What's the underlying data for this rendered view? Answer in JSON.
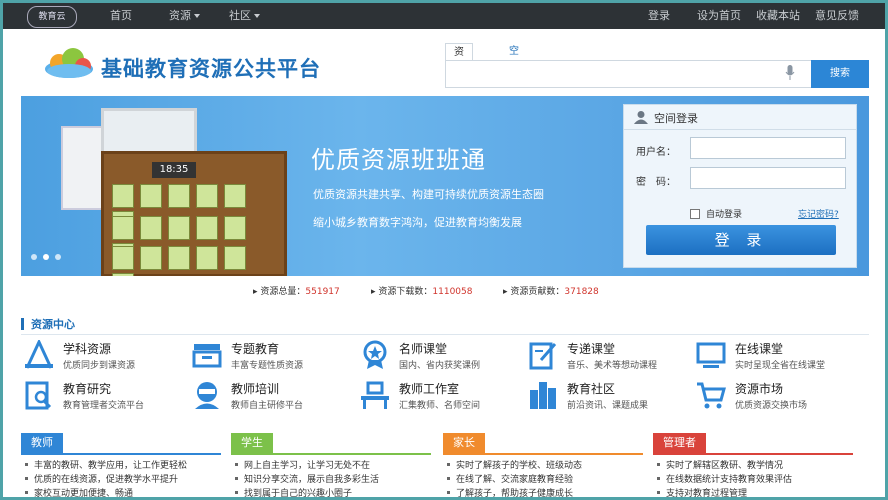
{
  "topbar": {
    "logo": "教育云",
    "nav": [
      {
        "label": "首页"
      },
      {
        "label": "资源"
      },
      {
        "label": "社区"
      }
    ],
    "links": [
      "登录",
      "设为首页",
      "收藏本站",
      "意见反馈"
    ]
  },
  "header": {
    "title": "基础教育资源公共平台",
    "search_tabs": [
      "资源",
      "空间"
    ],
    "search_value": "",
    "search_button": "搜索",
    "mic_icon": "microphone-icon"
  },
  "banner": {
    "title": "优质资源班班通",
    "line1": "优质资源共建共享、构建可持续优质资源生态圈",
    "line2": "缩小城乡教育数字鸿沟，促进教育均衡发展",
    "clock": "18:35"
  },
  "login": {
    "title": "空间登录",
    "username_label": "用户名：",
    "password_label": "密　码：",
    "username_value": "",
    "password_value": "",
    "remember_label": "自动登录",
    "forgot_label": "忘记密码?",
    "submit_label": "登 录"
  },
  "stats": [
    {
      "label": "资源总量：",
      "value": "551917"
    },
    {
      "label": "资源下载数：",
      "value": "1110058"
    },
    {
      "label": "资源贡献数：",
      "value": "371828"
    }
  ],
  "resource_center": {
    "title": "资源中心",
    "items": [
      {
        "title": "学科资源",
        "desc": "优质同步到课资源",
        "icon": "ruler-compass-icon"
      },
      {
        "title": "专题教育",
        "desc": "丰富专题性质资源",
        "icon": "tray-icon"
      },
      {
        "title": "名师课堂",
        "desc": "国内、省内获奖课例",
        "icon": "award-medal-icon"
      },
      {
        "title": "专递课堂",
        "desc": "音乐、美术等想动课程",
        "icon": "edit-document-icon"
      },
      {
        "title": "在线课堂",
        "desc": "实时呈现全省在线课堂",
        "icon": "monitor-icon"
      },
      {
        "title": "教育研究",
        "desc": "教育管理者交流平台",
        "icon": "clipboard-search-icon"
      },
      {
        "title": "教师培训",
        "desc": "教师自主研修平台",
        "icon": "teacher-icon"
      },
      {
        "title": "教师工作室",
        "desc": "汇集教师、名师空间",
        "icon": "desk-icon"
      },
      {
        "title": "教育社区",
        "desc": "前沿资讯、课题成果",
        "icon": "buildings-icon"
      },
      {
        "title": "资源市场",
        "desc": "优质资源交换市场",
        "icon": "shopping-cart-icon"
      }
    ]
  },
  "roles": [
    {
      "name": "教师",
      "color": "#2f86d6",
      "items": [
        "丰富的教研、教学应用，让工作更轻松",
        "优质的在线资源，促进教学水平提升",
        "家校互动更加便捷、畅通"
      ]
    },
    {
      "name": "学生",
      "color": "#7cc14a",
      "items": [
        "网上自主学习，让学习无处不在",
        "知识分享交流，展示自我多彩生活",
        "找到属于自己的兴趣小圈子"
      ]
    },
    {
      "name": "家长",
      "color": "#f08b2d",
      "items": [
        "实时了解孩子的学校、班级动态",
        "在线了解、交流家庭教育经验",
        "了解孩子，帮助孩子健康成长"
      ]
    },
    {
      "name": "管理者",
      "color": "#d9433b",
      "items": [
        "实时了解辖区教研、教学情况",
        "在线数据统计支持教育效果评估",
        "支持对教育过程管理"
      ]
    }
  ]
}
